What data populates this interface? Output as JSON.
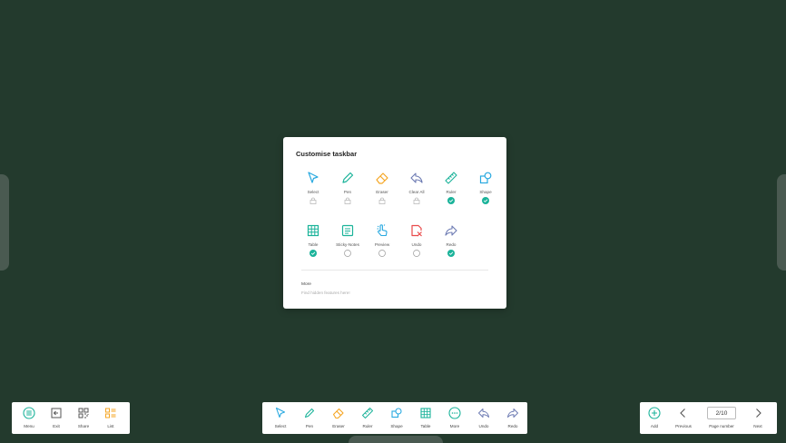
{
  "dialog": {
    "title": "Customise taskbar",
    "rows": [
      [
        {
          "label": "Select",
          "icon": "cursor-icon",
          "color": "#29a9e0",
          "state": "locked"
        },
        {
          "label": "Pen",
          "icon": "pen-icon",
          "color": "#1bb39a",
          "state": "locked"
        },
        {
          "label": "Eraser",
          "icon": "eraser-icon",
          "color": "#f5a623",
          "state": "locked"
        },
        {
          "label": "Clear All",
          "icon": "clear-all-icon",
          "color": "#6d7bb3",
          "state": "locked"
        },
        {
          "label": "Ruler",
          "icon": "ruler-icon",
          "color": "#1bb39a",
          "state": "checked"
        },
        {
          "label": "Shape",
          "icon": "shape-icon",
          "color": "#29a9e0",
          "state": "checked"
        }
      ],
      [
        {
          "label": "Table",
          "icon": "table-icon",
          "color": "#1bb39a",
          "state": "checked"
        },
        {
          "label": "Sticky-Notes",
          "icon": "sticky-notes-icon",
          "color": "#1bb39a",
          "state": "unchecked"
        },
        {
          "label": "Preview",
          "icon": "preview-icon",
          "color": "#29a9e0",
          "state": "unchecked"
        },
        {
          "label": "Undo",
          "icon": "undo-delete-icon",
          "color": "#e94b4b",
          "state": "unchecked"
        },
        {
          "label": "Redo",
          "icon": "redo-icon",
          "color": "#6d7bb3",
          "state": "checked"
        }
      ]
    ],
    "more": {
      "title": "More",
      "subtitle": "Find hidden features here!"
    }
  },
  "left_bar": [
    {
      "label": "Menu",
      "icon": "menu-icon"
    },
    {
      "label": "Exit",
      "icon": "exit-icon"
    },
    {
      "label": "Share",
      "icon": "share-icon"
    },
    {
      "label": "List",
      "icon": "list-icon"
    }
  ],
  "center_bar": [
    {
      "label": "Select",
      "icon": "cursor-icon"
    },
    {
      "label": "Pen",
      "icon": "pen-icon"
    },
    {
      "label": "Eraser",
      "icon": "eraser-icon"
    },
    {
      "label": "Ruler",
      "icon": "ruler-icon"
    },
    {
      "label": "Shape",
      "icon": "shape-icon"
    },
    {
      "label": "Table",
      "icon": "table-icon"
    },
    {
      "label": "More",
      "icon": "more-icon"
    },
    {
      "label": "Undo",
      "icon": "undo-icon"
    },
    {
      "label": "Redo",
      "icon": "redo-icon"
    }
  ],
  "right_bar": {
    "add_label": "Add",
    "previous_label": "Previous",
    "page_number_value": "2/10",
    "page_number_label": "Page number",
    "next_label": "Next"
  },
  "colors": {
    "background": "#233a2d",
    "accent": "#1bb39a",
    "check": "#1bb39a"
  }
}
